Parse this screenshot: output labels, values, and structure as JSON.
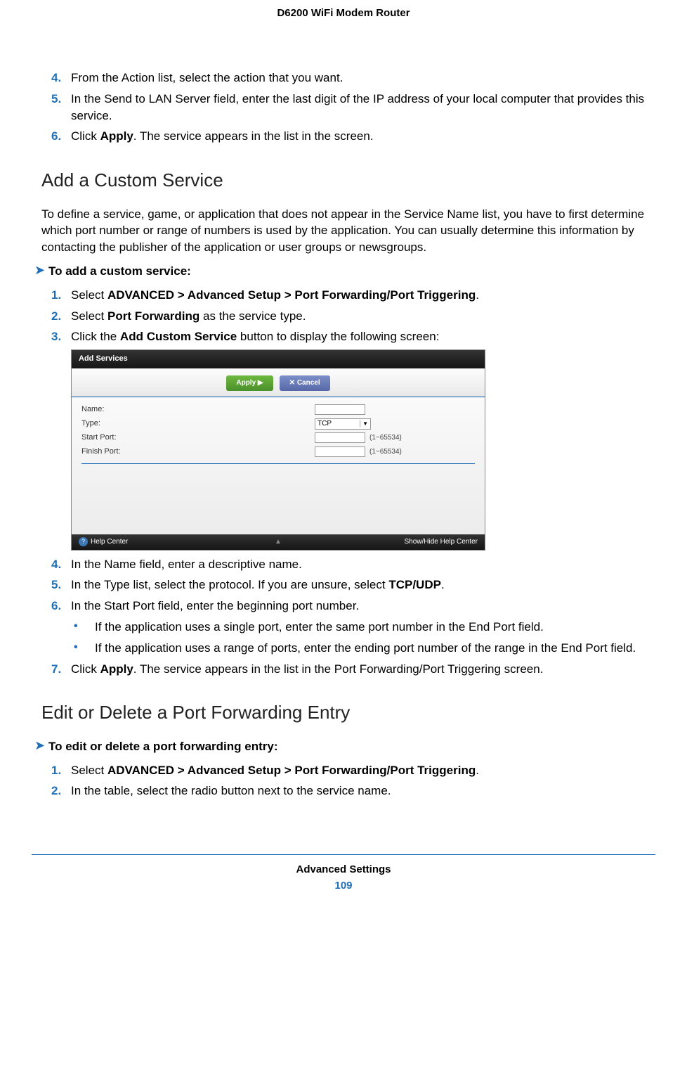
{
  "doc_title": "D6200 WiFi Modem Router",
  "list1": [
    {
      "n": "4.",
      "t": "From the Action list, select the action that you want."
    },
    {
      "n": "5.",
      "t": "In the Send to LAN Server field, enter the last digit of the IP address of your local computer that provides this service."
    },
    {
      "n": "6.",
      "t_pre": "Click ",
      "t_b": "Apply",
      "t_post": ". The service appears in the list in the screen."
    }
  ],
  "h2_1": "Add a Custom Service",
  "para1": "To define a service, game, or application that does not appear in the Service Name list, you have to first determine which port number or range of numbers is used by the application. You can usually determine this information by contacting the publisher of the application or user groups or newsgroups.",
  "proc1_title": "To add a custom service:",
  "list2": [
    {
      "n": "1.",
      "t_pre": "Select ",
      "t_b": "ADVANCED > Advanced Setup > Port Forwarding/Port Triggering",
      "t_post": "."
    },
    {
      "n": "2.",
      "t_pre": "Select ",
      "t_b": "Port Forwarding",
      "t_post": " as the service type."
    },
    {
      "n": "3.",
      "t_pre": "Click the ",
      "t_b": "Add Custom Service",
      "t_post": " button to display the following screen:"
    }
  ],
  "ui": {
    "header": "Add Services",
    "apply": "Apply ▶",
    "cancel": "✕ Cancel",
    "rows": {
      "name": "Name:",
      "type": "Type:",
      "type_val": "TCP",
      "start": "Start Port:",
      "finish": "Finish Port:",
      "hint": "(1~65534)"
    },
    "help": "Help Center",
    "show": "Show/Hide Help Center"
  },
  "list3": [
    {
      "n": "4.",
      "t": "In the Name field, enter a descriptive name."
    },
    {
      "n": "5.",
      "t_pre": "In the Type list, select the protocol. If you are unsure, select ",
      "t_b": "TCP/UDP",
      "t_post": "."
    },
    {
      "n": "6.",
      "t": "In the Start Port field, enter the beginning port number."
    }
  ],
  "bullets": [
    "If the application uses a single port, enter the same port number in the End Port field.",
    "If the application uses a range of ports, enter the ending port number of the range in the End Port field."
  ],
  "list4": [
    {
      "n": "7.",
      "t_pre": "Click ",
      "t_b": "Apply",
      "t_post": ". The service appears in the list in the Port Forwarding/Port Triggering screen."
    }
  ],
  "h2_2": "Edit or Delete a Port Forwarding Entry",
  "proc2_title": "To edit or delete a port forwarding entry:",
  "list5": [
    {
      "n": "1.",
      "t_pre": "Select ",
      "t_b": "ADVANCED > Advanced Setup > Port Forwarding/Port Triggering",
      "t_post": "."
    },
    {
      "n": "2.",
      "t": "In the table, select the radio button next to the service name."
    }
  ],
  "footer_section": "Advanced Settings",
  "footer_num": "109"
}
